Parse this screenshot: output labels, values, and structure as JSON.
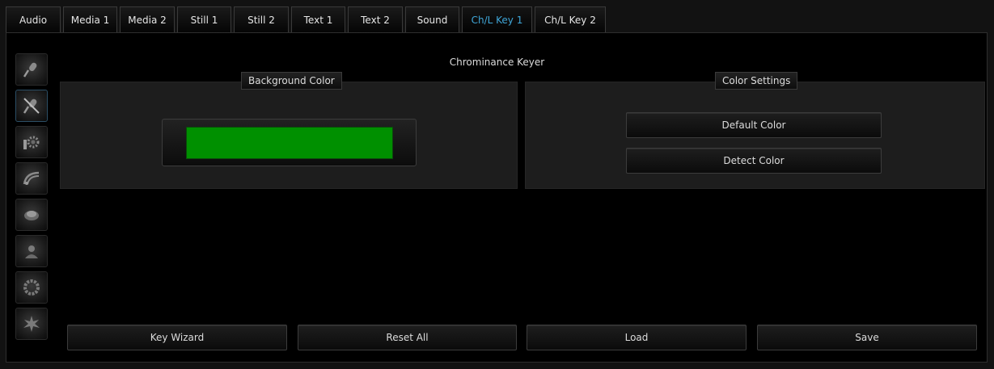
{
  "tabs": [
    {
      "label": "Audio"
    },
    {
      "label": "Media 1"
    },
    {
      "label": "Media 2"
    },
    {
      "label": "Still 1"
    },
    {
      "label": "Still 2"
    },
    {
      "label": "Text 1"
    },
    {
      "label": "Text 2"
    },
    {
      "label": "Sound"
    },
    {
      "label": "Ch/L Key 1"
    },
    {
      "label": "Ch/L Key 2"
    }
  ],
  "active_tab": "Ch/L Key 1",
  "colors": {
    "active_tab_text": "#3fa6d8",
    "key_color": "#009000"
  },
  "sidebar": {
    "icons": [
      {
        "name": "microphone-icon"
      },
      {
        "name": "no-microphone-icon",
        "active": true
      },
      {
        "name": "gear-icon"
      },
      {
        "name": "satellite-dish-icon"
      },
      {
        "name": "disc-icon"
      },
      {
        "name": "person-icon"
      },
      {
        "name": "ring-icon"
      },
      {
        "name": "splash-icon"
      }
    ]
  },
  "page_title": "Chrominance Keyer",
  "background_color": {
    "label": "Background Color"
  },
  "color_settings": {
    "label": "Color Settings",
    "default_label": "Default Color",
    "detect_label": "Detect Color"
  },
  "footer": {
    "key_wizard": "Key Wizard",
    "reset_all": "Reset All",
    "load": "Load",
    "save": "Save"
  }
}
